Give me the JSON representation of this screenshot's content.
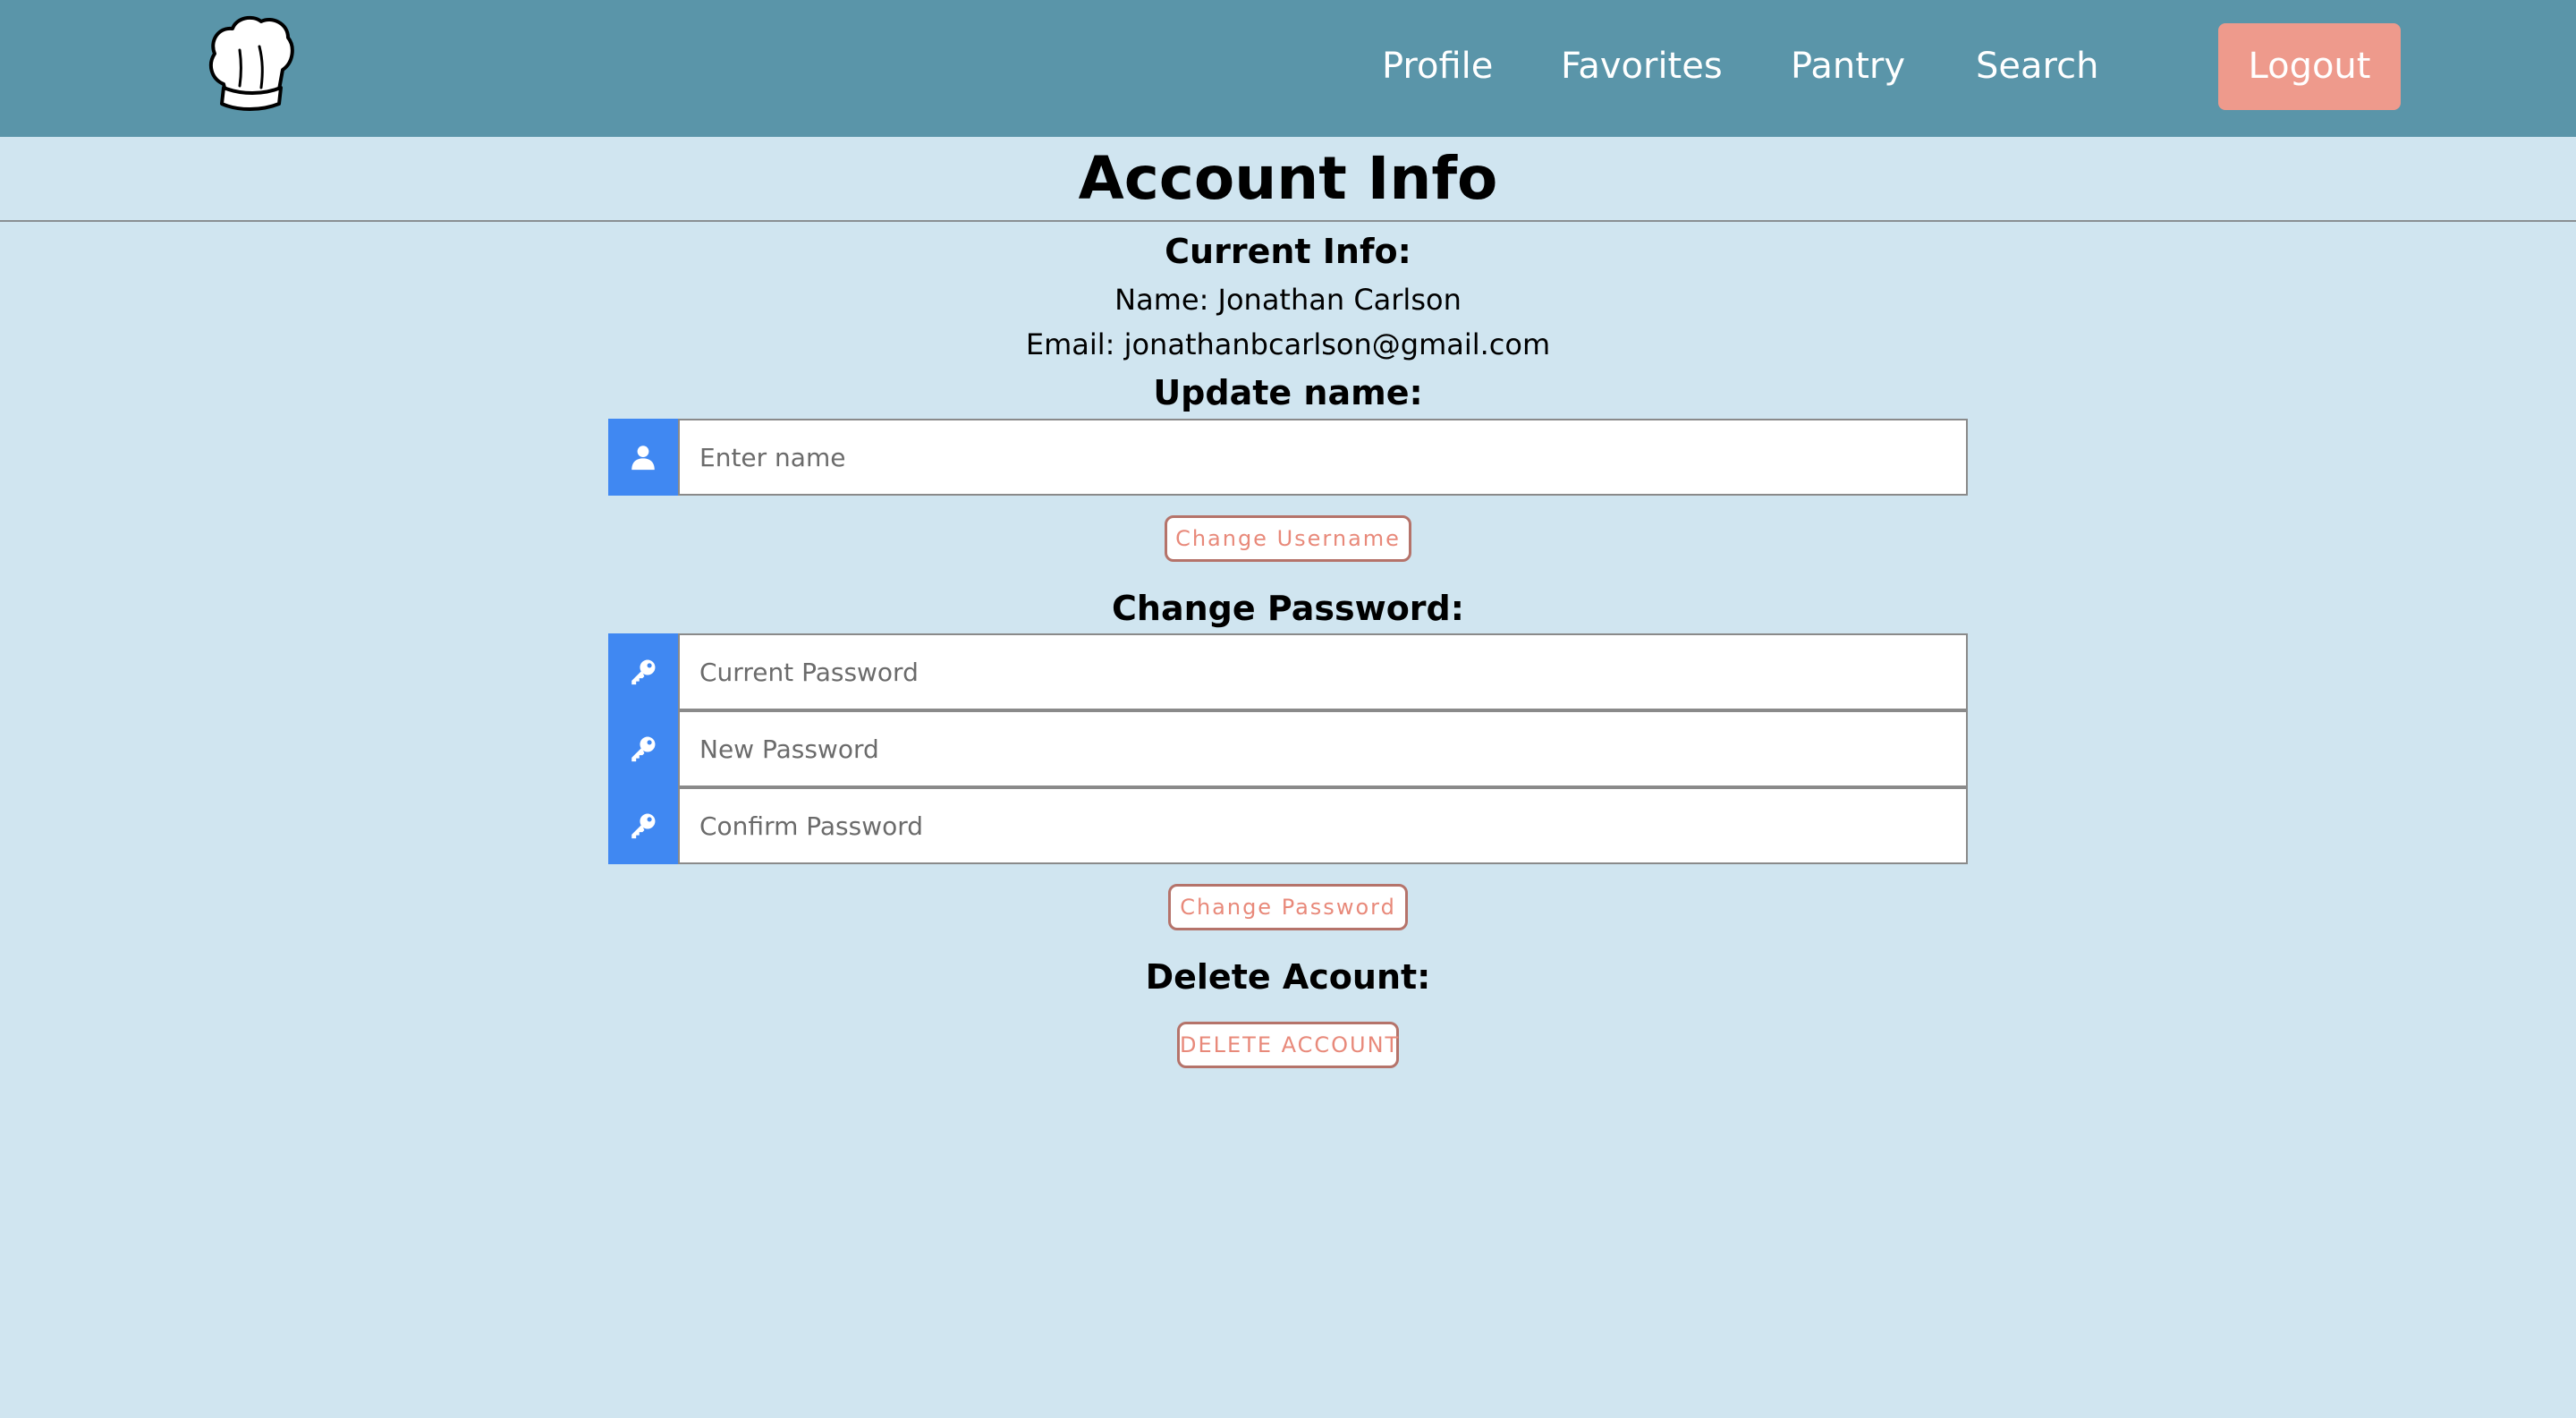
{
  "nav": {
    "logo_icon": "chef-hat-icon",
    "links": [
      "Profile",
      "Favorites",
      "Pantry",
      "Search"
    ],
    "logout_label": "Logout"
  },
  "page": {
    "title": "Account Info"
  },
  "current_info": {
    "heading": "Current Info:",
    "name_line": "Name: Jonathan Carlson",
    "email_line": "Email: jonathanbcarlson@gmail.com"
  },
  "update_name": {
    "heading": "Update name:",
    "icon": "user-icon",
    "placeholder": "Enter name",
    "value": "",
    "button_label": "Change Username"
  },
  "change_password": {
    "heading": "Change Password:",
    "icon": "key-icon",
    "current_placeholder": "Current Password",
    "new_placeholder": "New Password",
    "confirm_placeholder": "Confirm Password",
    "button_label": "Change Password"
  },
  "delete_account": {
    "heading": "Delete Acount:",
    "button_label": "DELETE ACCOUNT"
  },
  "colors": {
    "navbar": "#5a95a9",
    "background": "#d0e5f0",
    "logout": "#ee9a8c",
    "icon_block": "#4088f2",
    "button_text": "#e8897a"
  }
}
